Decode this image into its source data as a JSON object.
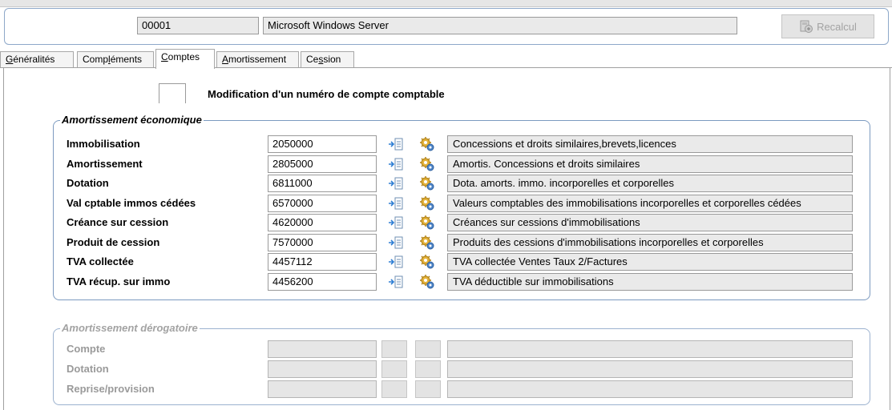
{
  "header": {
    "code": "00001",
    "name": "Microsoft Windows Server",
    "recalc_label": "Recalcul"
  },
  "tabs": [
    {
      "pre": "",
      "ul": "G",
      "post": "énéralités"
    },
    {
      "pre": "Comp",
      "ul": "l",
      "post": "éments"
    },
    {
      "pre": "",
      "ul": "C",
      "post": "omptes"
    },
    {
      "pre": "",
      "ul": "A",
      "post": "mortissement"
    },
    {
      "pre": "Ce",
      "ul": "s",
      "post": "sion"
    }
  ],
  "modification_label": "Modification d'un numéro de compte comptable",
  "eco": {
    "legend": "Amortissement économique",
    "rows": [
      {
        "label": "Immobilisation",
        "account": "2050000",
        "description": "Concessions et droits similaires,brevets,licences"
      },
      {
        "label": "Amortissement",
        "account": "2805000",
        "description": "Amortis. Concessions et droits similaires"
      },
      {
        "label": "Dotation",
        "account": "6811000",
        "description": "Dota. amorts. immo. incorporelles et corporelles"
      },
      {
        "label": "Val cptable immos cédées",
        "account": "6570000",
        "description": "Valeurs comptables des immobilisations incorporelles et corporelles cédées"
      },
      {
        "label": "Créance sur cession",
        "account": "4620000",
        "description": "Créances sur cessions d'immobilisations"
      },
      {
        "label": "Produit de cession",
        "account": "7570000",
        "description": "Produits des cessions d'immobilisations incorporelles et corporelles"
      },
      {
        "label": "TVA collectée",
        "account": "4457112",
        "description": "TVA collectée Ventes Taux 2/Factures"
      },
      {
        "label": "TVA récup. sur immo",
        "account": "4456200",
        "description": "TVA déductible sur immobilisations"
      }
    ]
  },
  "derog": {
    "legend": "Amortissement dérogatoire",
    "rows": [
      {
        "label": "Compte",
        "account": "",
        "description": ""
      },
      {
        "label": "Dotation",
        "account": "",
        "description": ""
      },
      {
        "label": "Reprise/provision",
        "account": "",
        "description": ""
      }
    ]
  },
  "icons": {
    "lookup": "list-lookup-icon",
    "gear": "gear-settings-icon",
    "recalc": "calculator-icon"
  }
}
